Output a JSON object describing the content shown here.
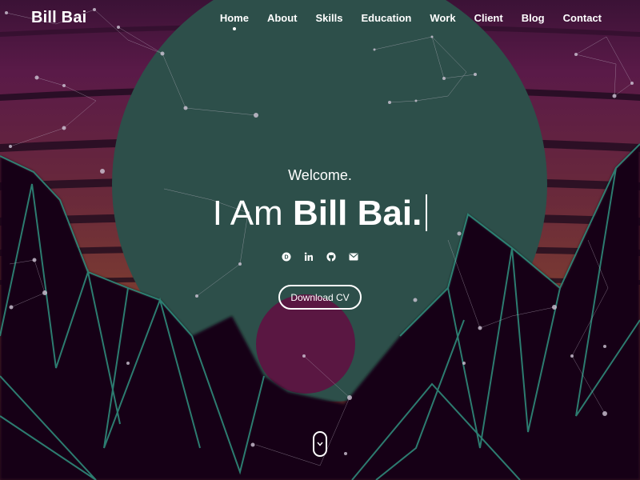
{
  "brand": {
    "name": "Bill Bai"
  },
  "nav": {
    "items": [
      {
        "label": "Home",
        "active": true
      },
      {
        "label": "About",
        "active": false
      },
      {
        "label": "Skills",
        "active": false
      },
      {
        "label": "Education",
        "active": false
      },
      {
        "label": "Work",
        "active": false
      },
      {
        "label": "Client",
        "active": false
      },
      {
        "label": "Blog",
        "active": false
      },
      {
        "label": "Contact",
        "active": false
      }
    ]
  },
  "hero": {
    "greeting": "Welcome.",
    "headline_prefix": "I Am ",
    "headline_name": "Bill Bai.",
    "download_label": "Download CV"
  },
  "socials": [
    {
      "icon": "dev-badge-icon"
    },
    {
      "icon": "linkedin-icon"
    },
    {
      "icon": "github-icon"
    },
    {
      "icon": "email-icon"
    }
  ],
  "colors": {
    "sky_magenta": "#5a1a48",
    "sun_teal": "#2d4f4a",
    "mountain_dark": "#120618",
    "neon_edge": "#2f8a7a",
    "small_sun": "#5a1742"
  }
}
